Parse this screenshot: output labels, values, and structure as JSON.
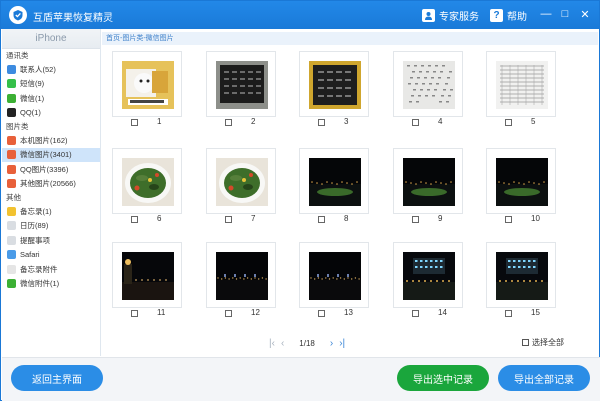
{
  "app": {
    "title": "互盾苹果恢复精灵",
    "logo_icon": "shield-check-icon",
    "accent": "#1a7ad8"
  },
  "toolbar": {
    "expert_label": "专家服务",
    "expert_icon": "expert-support-icon",
    "help_label": "帮助",
    "help_icon": "help-question-icon",
    "minimize_glyph": "—",
    "maximize_glyph": "□",
    "close_glyph": "✕"
  },
  "sidebar": {
    "device": "iPhone",
    "groups": [
      {
        "label": "通讯类",
        "items": [
          {
            "label": "联系人(52)",
            "icon": "contacts-icon",
            "color": "#3d8be0"
          },
          {
            "label": "短信(9)",
            "icon": "sms-icon",
            "color": "#35c04a"
          },
          {
            "label": "微信(1)",
            "icon": "wechat-icon",
            "color": "#3cb034"
          },
          {
            "label": "QQ(1)",
            "icon": "qq-icon",
            "color": "#222222"
          }
        ]
      },
      {
        "label": "图片类",
        "items": [
          {
            "label": "本机图片(162)",
            "icon": "photos-icon",
            "color": "#e8603a"
          },
          {
            "label": "微信图片(3401)",
            "icon": "wechat-photos-icon",
            "color": "#e8603a",
            "active": true
          },
          {
            "label": "QQ图片(3396)",
            "icon": "qq-photos-icon",
            "color": "#e8603a"
          },
          {
            "label": "其他图片(20566)",
            "icon": "other-photos-icon",
            "color": "#e8603a"
          }
        ]
      },
      {
        "label": "其他",
        "items": [
          {
            "label": "备忘录(1)",
            "icon": "notes-icon",
            "color": "#f2c230"
          },
          {
            "label": "日历(89)",
            "icon": "calendar-icon",
            "color": "#d9dde2"
          },
          {
            "label": "提醒事项",
            "icon": "reminders-icon",
            "color": "#d9dde2"
          },
          {
            "label": "Safari",
            "icon": "safari-icon",
            "color": "#4a9be8"
          },
          {
            "label": "备忘录附件",
            "icon": "notes-attachment-icon",
            "color": "#e5e5e5"
          },
          {
            "label": "微信附件(1)",
            "icon": "wechat-attachment-icon",
            "color": "#3cb034"
          }
        ]
      }
    ]
  },
  "breadcrumb": "首页-图片类-微信图片",
  "photos": [
    {
      "num": "1",
      "kind": "cat"
    },
    {
      "num": "2",
      "kind": "screen"
    },
    {
      "num": "3",
      "kind": "screen-yellow"
    },
    {
      "num": "4",
      "kind": "paper"
    },
    {
      "num": "5",
      "kind": "paper2"
    },
    {
      "num": "6",
      "kind": "food"
    },
    {
      "num": "7",
      "kind": "food"
    },
    {
      "num": "8",
      "kind": "night"
    },
    {
      "num": "9",
      "kind": "night"
    },
    {
      "num": "10",
      "kind": "night"
    },
    {
      "num": "11",
      "kind": "night-street"
    },
    {
      "num": "12",
      "kind": "night-dark"
    },
    {
      "num": "13",
      "kind": "night-dark"
    },
    {
      "num": "14",
      "kind": "night-lights"
    },
    {
      "num": "15",
      "kind": "night-lights"
    }
  ],
  "pagination": {
    "first_glyph": "|‹",
    "prev_glyph": "‹",
    "page": "1/18",
    "next_glyph": "›",
    "last_glyph": "›|"
  },
  "select_all_label": "选择全部",
  "footer": {
    "back_label": "返回主界面",
    "export_selected_label": "导出选中记录",
    "export_all_label": "导出全部记录"
  }
}
